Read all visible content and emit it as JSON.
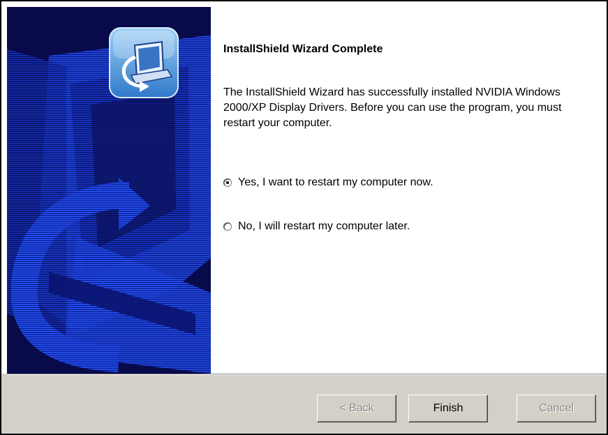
{
  "dialog": {
    "title": "InstallShield Wizard Complete",
    "description": "The InstallShield Wizard has successfully installed NVIDIA Windows 2000/XP Display Drivers.  Before you can use the program, you must restart your computer.",
    "options": {
      "restart_now": {
        "label": "Yes, I want to restart my computer now.",
        "selected": true
      },
      "restart_later": {
        "label": "No, I will restart my computer later.",
        "selected": false
      }
    }
  },
  "banner": {
    "icon": "computer-setup-icon",
    "background_color": "#0a0d55",
    "accent_color": "#2a5bff"
  },
  "buttons": {
    "back": "< Back",
    "finish": "Finish",
    "cancel": "Cancel"
  }
}
